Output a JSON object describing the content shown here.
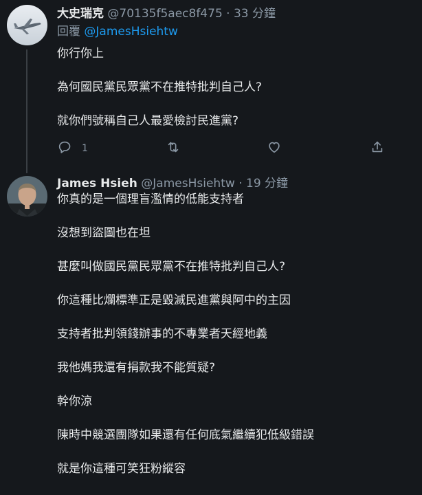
{
  "tweets": [
    {
      "name": "大史瑞克",
      "handle": "@70135f5aec8f475",
      "separator": "·",
      "time": "33 分鐘",
      "reply_prefix": "回覆",
      "reply_mention": "@JamesHsiehtw",
      "lines": [
        "你行你上",
        "為何國民黨民眾黨不在推特批判自己人?",
        "就你們號稱自己人最愛檢討民進黨?"
      ],
      "reply_count": "1"
    },
    {
      "name": "James Hsieh",
      "handle": "@JamesHsiehtw",
      "separator": "·",
      "time": "19 分鐘",
      "lines": [
        "你真的是一個理盲濫情的低能支持者",
        "沒想到盜圖也在坦",
        "甚麼叫做國民黨民眾黨不在推特批判自己人?",
        "你這種比爛標準正是毀滅民進黨與阿中的主因",
        "支持者批判領錢辦事的不專業者天經地義",
        "我他媽我還有捐款我不能質疑?",
        "幹你涼",
        "陳時中競選團隊如果還有任何底氣繼續犯低級錯誤",
        "就是你這種可笑狂粉縱容"
      ]
    }
  ],
  "icons": {
    "reply": "reply-icon",
    "retweet": "retweet-icon",
    "like": "heart-icon",
    "share": "share-icon"
  },
  "colors": {
    "background": "#15181c",
    "text": "#e7e9ea",
    "secondary": "#8b98a5",
    "link": "#1d9bf0"
  }
}
